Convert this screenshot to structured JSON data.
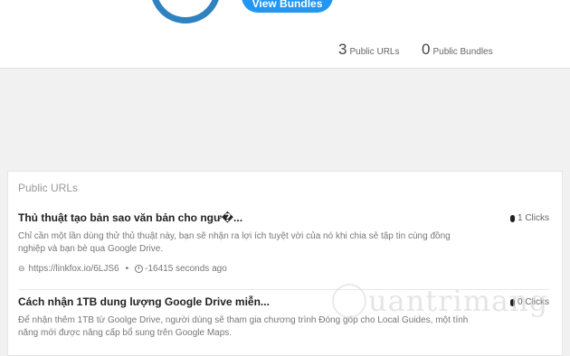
{
  "header": {
    "view_bundles_label": "View Bundles",
    "stats": [
      {
        "count": "3",
        "label": "Public URLs"
      },
      {
        "count": "0",
        "label": "Public Bundles"
      }
    ]
  },
  "public_urls": {
    "title": "Public URLs",
    "items": [
      {
        "title": "Thủ thuật tạo bản sao văn bản cho ngư�...",
        "clicks": "1 Clicks",
        "description": "Chỉ cần một lần dùng thử thủ thuật này, bạn sẽ nhận ra lợi ích tuyệt vời của nó khi chia sẻ tập tin cùng đồng nghiệp và bạn bè qua Google Drive.",
        "url": "https://linkfox.io/6LJS6",
        "time": "-16415 seconds ago"
      },
      {
        "title": "Cách nhận 1TB dung lượng Google Drive miễn...",
        "clicks": "0 Clicks",
        "description": "Để nhận thêm 1TB từ Goolge Drive, người dùng sẽ tham gia chương trình Đóng góp cho Local Guides, một tính năng mới được nâng cấp bổ sung trên Google Maps."
      }
    ]
  },
  "icons": {
    "link": "link-icon",
    "clock": "clock-icon",
    "mouse": "mouse-icon"
  },
  "watermark": {
    "text": "uantrimang"
  }
}
